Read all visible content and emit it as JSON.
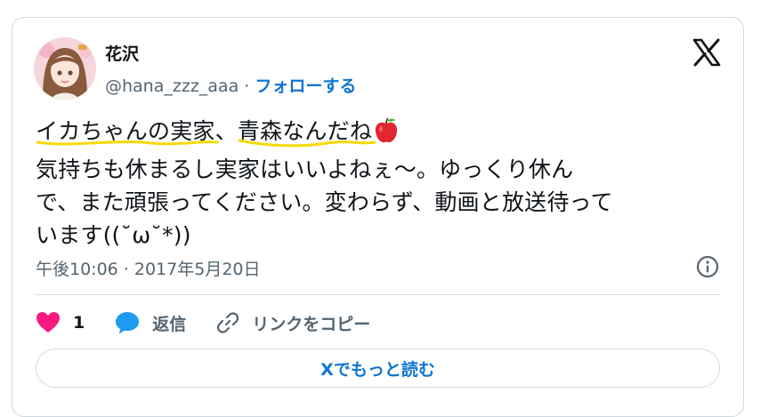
{
  "author": {
    "name": "花沢",
    "handle": "@hana_zzz_aaa",
    "separator": "·",
    "follow_label": "フォローする"
  },
  "tweet": {
    "line1_a": "イカちゃんの実家",
    "line1_b": "、",
    "line1_c": "青森なんだね",
    "line2": "気持ちも休まるし実家はいいよねぇ〜。ゆっくり休ん",
    "line3": "で、また頑張ってください。変わらず、動画と放送待って",
    "line4": "います((˘ω˘*))",
    "emoji": "apple-emoji"
  },
  "timestamp": "午後10:06 · 2017年5月20日",
  "actions": {
    "like_count": "1",
    "reply_label": "返信",
    "copy_link_label": "リンクをコピー"
  },
  "read_more_label": "Xでもっと読む",
  "colors": {
    "accent": "#0f75d0",
    "like": "#f91880",
    "reply": "#1d9bf0",
    "underline": "#f5d90a",
    "muted": "#536471"
  }
}
